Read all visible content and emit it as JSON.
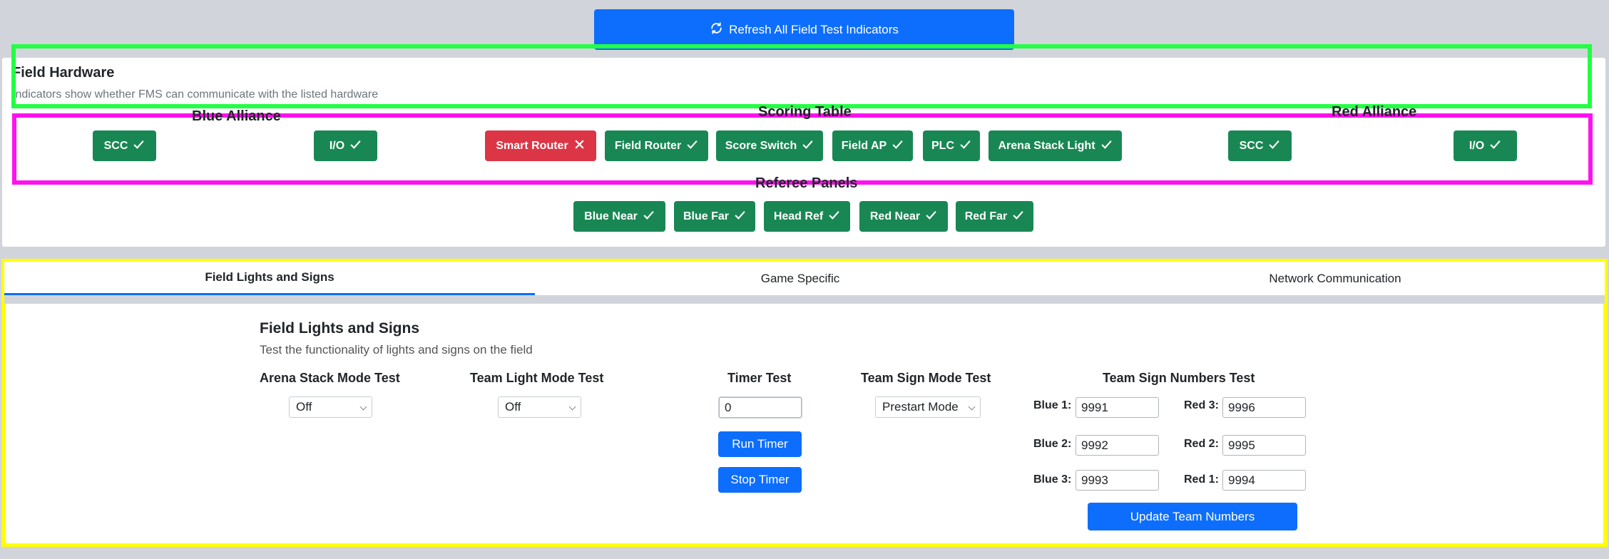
{
  "refresh_button": {
    "label": "Refresh All Field Test Indicators",
    "icon": "refresh-icon"
  },
  "hardware": {
    "title": "Field Hardware",
    "subtitle": "Indicators show whether FMS can communicate with the listed hardware",
    "blue_alliance": {
      "title": "Blue Alliance",
      "items": [
        {
          "label": "SCC",
          "status": "ok"
        },
        {
          "label": "I/O",
          "status": "ok"
        }
      ]
    },
    "scoring_table": {
      "title": "Scoring Table",
      "items": [
        {
          "label": "Smart Router",
          "status": "error"
        },
        {
          "label": "Field Router",
          "status": "ok"
        },
        {
          "label": "Score Switch",
          "status": "ok"
        },
        {
          "label": "Field AP",
          "status": "ok"
        },
        {
          "label": "PLC",
          "status": "ok"
        },
        {
          "label": "Arena Stack Light",
          "status": "ok"
        }
      ]
    },
    "red_alliance": {
      "title": "Red Alliance",
      "items": [
        {
          "label": "SCC",
          "status": "ok"
        },
        {
          "label": "I/O",
          "status": "ok"
        }
      ]
    },
    "referee_panels": {
      "title": "Referee Panels",
      "items": [
        {
          "label": "Blue Near",
          "status": "ok"
        },
        {
          "label": "Blue Far",
          "status": "ok"
        },
        {
          "label": "Head Ref",
          "status": "ok"
        },
        {
          "label": "Red Near",
          "status": "ok"
        },
        {
          "label": "Red Far",
          "status": "ok"
        }
      ]
    }
  },
  "tabs": [
    {
      "label": "Field Lights and Signs",
      "active": true
    },
    {
      "label": "Game Specific",
      "active": false
    },
    {
      "label": "Network Communication",
      "active": false
    }
  ],
  "lights_panel": {
    "title": "Field Lights and Signs",
    "subtitle": "Test the functionality of lights and signs on the field",
    "arena_stack": {
      "label": "Arena Stack Mode Test",
      "value": "Off"
    },
    "team_light": {
      "label": "Team Light Mode Test",
      "value": "Off"
    },
    "timer": {
      "label": "Timer Test",
      "value": "0",
      "run_label": "Run Timer",
      "stop_label": "Stop Timer"
    },
    "team_sign": {
      "label": "Team Sign Mode Test",
      "value": "Prestart Mode"
    },
    "team_numbers": {
      "label": "Team Sign Numbers Test",
      "blue1": {
        "label": "Blue 1:",
        "value": "9991"
      },
      "blue2": {
        "label": "Blue 2:",
        "value": "9992"
      },
      "blue3": {
        "label": "Blue 3:",
        "value": "9993"
      },
      "red3": {
        "label": "Red 3:",
        "value": "9996"
      },
      "red2": {
        "label": "Red 2:",
        "value": "9995"
      },
      "red1": {
        "label": "Red 1:",
        "value": "9994"
      },
      "update_label": "Update Team Numbers"
    }
  },
  "colors": {
    "primary": "#0d6efd",
    "success": "#198754",
    "danger": "#dc3545",
    "outline_green": "#22ff44",
    "outline_magenta": "#ff11ee",
    "outline_yellow": "#ffff00"
  }
}
